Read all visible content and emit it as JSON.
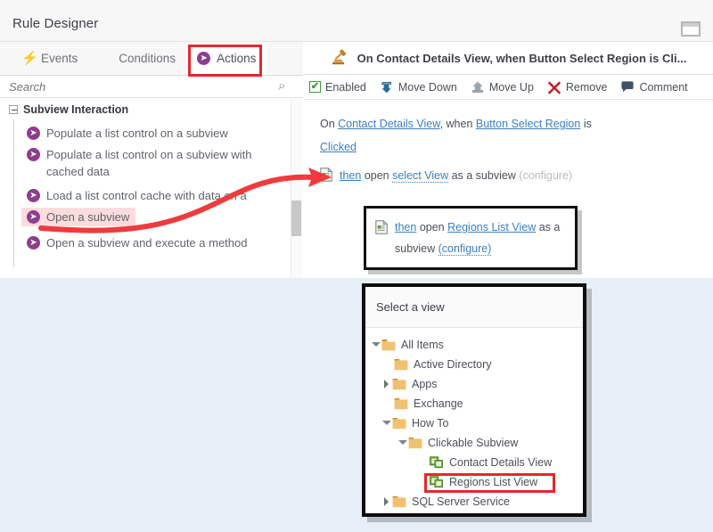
{
  "window": {
    "title": "Rule Designer",
    "restore_icon": "window-restore-icon"
  },
  "tabs": [
    {
      "label": "Events",
      "icon": "bolt-icon",
      "active": false
    },
    {
      "label": "Conditions",
      "icon": "diamond-icon",
      "active": false
    },
    {
      "label": "Actions",
      "icon": "arrow-circle-icon",
      "active": true
    }
  ],
  "search": {
    "placeholder": "Search",
    "value": "",
    "icon": "search-icon"
  },
  "action_tree": {
    "group_label": "Subview Interaction",
    "items": [
      {
        "label": "Populate a list control on a subview",
        "selected": false
      },
      {
        "label": "Populate a list control on a subview with cached data",
        "selected": false
      },
      {
        "label": "Load a list control cache with data on a subview",
        "selected": false
      },
      {
        "label": "Open a subview",
        "selected": true
      },
      {
        "label": "Open a subview and execute a method",
        "selected": false
      }
    ]
  },
  "rule": {
    "header_title": "On Contact Details View, when Button Select Region is Cli...",
    "header_icon": "gavel-icon",
    "toolbar": [
      {
        "label": "Enabled",
        "icon": "checkbox-checked-icon"
      },
      {
        "label": "Move Down",
        "icon": "move-down-icon"
      },
      {
        "label": "Move Up",
        "icon": "move-up-icon"
      },
      {
        "label": "Remove",
        "icon": "remove-x-icon"
      },
      {
        "label": "Comment",
        "icon": "comment-icon"
      }
    ],
    "definition": {
      "on_word": "On ",
      "event_view": "Contact Details View",
      "when_word": ", when ",
      "event_control": "Button Select Region",
      "is_word": " is",
      "event_action": "Clicked"
    },
    "step": {
      "icon": "view-document-icon",
      "then": "then",
      "open": " open ",
      "target": "select View",
      "suffix": " as a subview ",
      "configure": "(configure)"
    }
  },
  "callout": {
    "icon": "view-document-icon",
    "then": "then",
    "open": " open ",
    "target": "Regions List View",
    "suffix_line1": " as a",
    "suffix_line2": "subview ",
    "configure": "(configure)"
  },
  "dialog": {
    "title": "Select a view",
    "tree": [
      {
        "label": "All Items",
        "indent": 0,
        "toggle": "down",
        "icon": "folder-icon",
        "highlight": false
      },
      {
        "label": "Active Directory",
        "indent": 1,
        "toggle": "none",
        "icon": "folder-icon",
        "highlight": false
      },
      {
        "label": "Apps",
        "indent": 1,
        "toggle": "right",
        "icon": "folder-icon",
        "highlight": false
      },
      {
        "label": "Exchange",
        "indent": 1,
        "toggle": "none",
        "icon": "folder-icon",
        "highlight": false
      },
      {
        "label": "How To",
        "indent": 1,
        "toggle": "down",
        "icon": "folder-icon",
        "highlight": false
      },
      {
        "label": "Clickable Subview",
        "indent": 2,
        "toggle": "down",
        "icon": "folder-icon",
        "highlight": false
      },
      {
        "label": "Contact Details View",
        "indent": 3,
        "toggle": "none",
        "icon": "view-icon",
        "highlight": false
      },
      {
        "label": "Regions List View",
        "indent": 3,
        "toggle": "none",
        "icon": "view-icon",
        "highlight": true
      },
      {
        "label": "SQL Server Service",
        "indent": 1,
        "toggle": "right",
        "icon": "folder-icon",
        "highlight": false
      }
    ]
  },
  "annotations": {
    "color": "#e8262d",
    "targets": [
      "actions-tab",
      "select-view-link",
      "regions-list-view-link",
      "regions-list-view-tree-item"
    ],
    "arrow": "open-a-subview-to-step-arrow"
  },
  "colors": {
    "accent_purple": "#8e3d8e",
    "link_blue": "#3a7fc1",
    "annotation_red": "#e8262d",
    "selection_pink": "#fadcdc",
    "page_background": "#e6eff8"
  }
}
